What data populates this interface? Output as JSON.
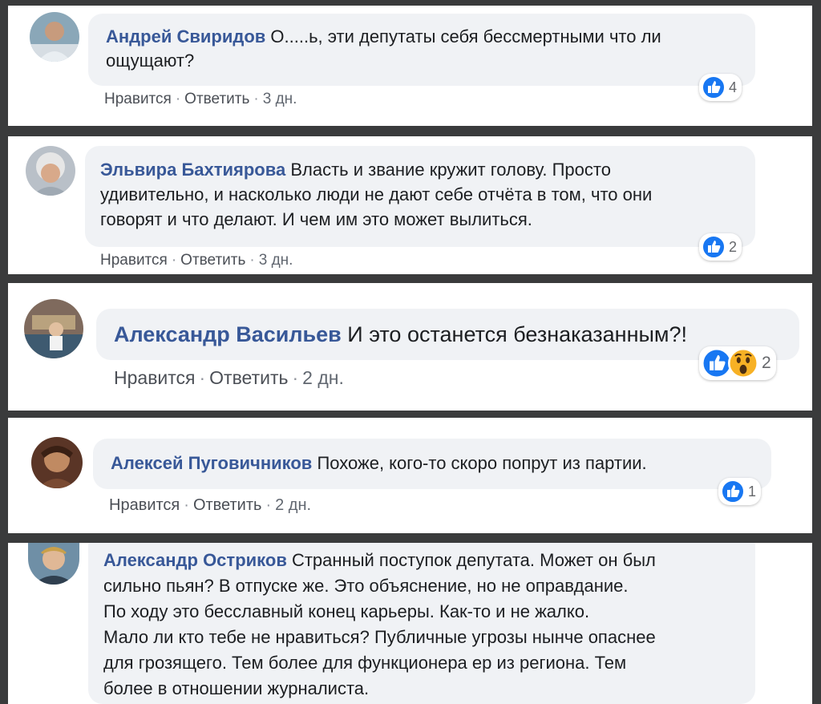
{
  "comments": [
    {
      "author": "Андрей Свиридов",
      "lines": [
        "О.....ь, эти депутаты себя бессмертными что ли",
        "ощущают?"
      ],
      "like_label": "Нравится",
      "reply_label": "Ответить",
      "time": "3 дн.",
      "reaction_count": "4"
    },
    {
      "author": "Эльвира Бахтиярова",
      "lines": [
        "Власть и звание кружит голову. Просто",
        "удивительно, и насколько люди не дают себе отчёта в том, что они",
        "говорят и что делают. И чем им это может вылиться."
      ],
      "like_label": "Нравится",
      "reply_label": "Ответить",
      "time": "3 дн.",
      "reaction_count": "2"
    },
    {
      "author": "Александр Васильев",
      "lines": [
        "И это останется безнаказанным?!"
      ],
      "like_label": "Нравится",
      "reply_label": "Ответить",
      "time": "2 дн.",
      "reaction_count": "2"
    },
    {
      "author": "Алексей Пуговичников",
      "lines": [
        "Похоже, кого-то скоро попрут из партии."
      ],
      "like_label": "Нравится",
      "reply_label": "Ответить",
      "time": "2 дн.",
      "reaction_count": "1"
    },
    {
      "author": "Александр Остриков",
      "lines": [
        "Странный поступок депутата. Может он был",
        "сильно пьян? В отпуске же. Это объяснение, но не оправдание.",
        "По ходу это бесславный конец карьеры. Как-то и не жалко.",
        "Мало ли кто тебе не нравиться? Публичные угрозы нынче опаснее",
        "для грозящего. Тем более для функционера ер из региона. Тем",
        "более в отношении журналиста."
      ]
    }
  ],
  "separator": "·",
  "icons": {
    "like": "like-icon",
    "wow": "wow-icon"
  },
  "colors": {
    "author": "#385898",
    "bubble": "#f0f2f5",
    "like_blue": "#1877f2",
    "wow_yellow": "#f7b125",
    "frame": "#3a3b3c"
  }
}
